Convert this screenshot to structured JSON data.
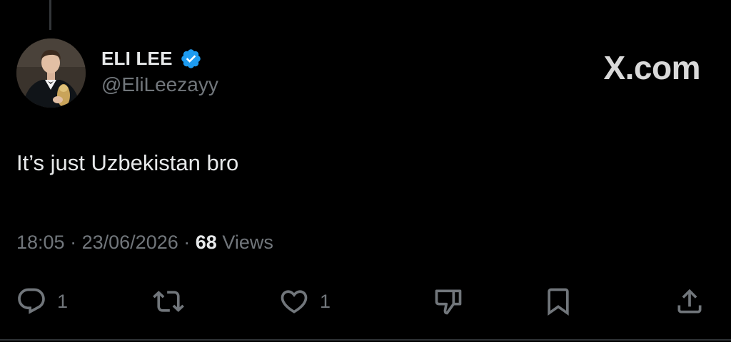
{
  "author": {
    "display_name": "ELI LEE",
    "handle": "@EliLeezayy",
    "verified": true,
    "verified_color": "#1d9bf0"
  },
  "brand": {
    "label": "X.com"
  },
  "tweet": {
    "text": "It’s just Uzbekistan bro"
  },
  "meta": {
    "time": "18:05",
    "separator": "·",
    "date": "23/06/2026",
    "views_count": "68",
    "views_label": "Views"
  },
  "actions": {
    "reply": {
      "icon": "reply-icon",
      "count": "1"
    },
    "repost": {
      "icon": "repost-icon",
      "count": ""
    },
    "like": {
      "icon": "heart-icon",
      "count": "1"
    },
    "dislike": {
      "icon": "thumbs-down-icon"
    },
    "bookmark": {
      "icon": "bookmark-icon"
    },
    "share": {
      "icon": "share-icon"
    }
  },
  "colors": {
    "background": "#000000",
    "primary_text": "#e7e9ea",
    "secondary_text": "#71767b",
    "divider": "#2f3336"
  }
}
